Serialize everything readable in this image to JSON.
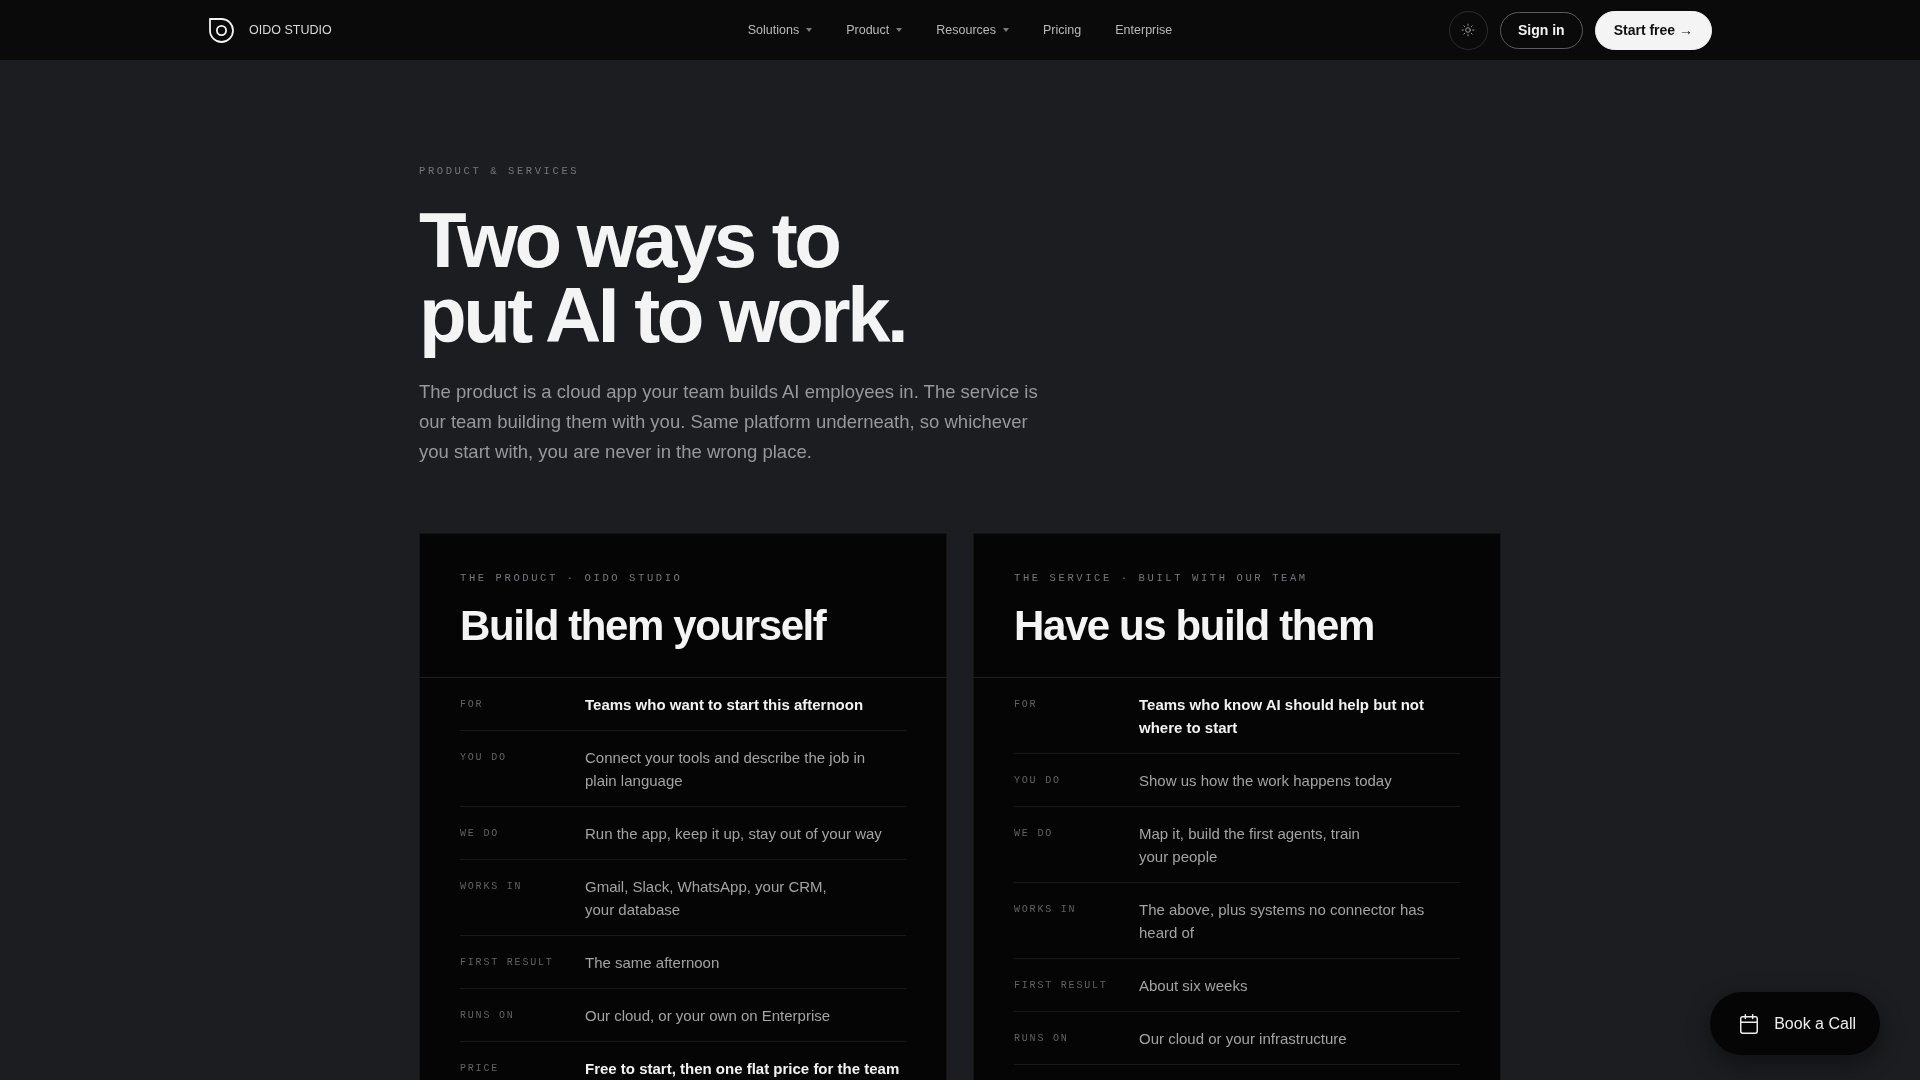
{
  "nav": {
    "brand": "OIDO STUDIO",
    "links": [
      {
        "label": "Solutions",
        "dropdown": true
      },
      {
        "label": "Product",
        "dropdown": true
      },
      {
        "label": "Resources",
        "dropdown": true
      },
      {
        "label": "Pricing",
        "dropdown": false
      },
      {
        "label": "Enterprise",
        "dropdown": false
      }
    ],
    "buttons": [
      {
        "label": "Sign in",
        "kind": "login"
      },
      {
        "label": "Start free →",
        "kind": "signup"
      }
    ]
  },
  "hero": {
    "eyebrow": "PRODUCT & SERVICES",
    "title": "Two ways to\nput AI to work.",
    "intro": "The product is a cloud app your team builds AI employees in. The service is\nour team building them with you. Same platform underneath, so whichever\nyou start with, you are never in the wrong place."
  },
  "cards": [
    {
      "eyebrow": "THE PRODUCT · OIDO STUDIO",
      "title": "Build them yourself",
      "rows": [
        {
          "label": "FOR",
          "value": "Teams who want to start this afternoon",
          "strong": true
        },
        {
          "label": "YOU DO",
          "value": "Connect your tools and describe the job in\nplain language",
          "strong": false
        },
        {
          "label": "WE DO",
          "value": "Run the app, keep it up, stay out of your way",
          "strong": false
        },
        {
          "label": "WORKS IN",
          "value": "Gmail, Slack, WhatsApp, your CRM,\nyour database",
          "strong": false
        },
        {
          "label": "FIRST RESULT",
          "value": "The same afternoon",
          "strong": false
        },
        {
          "label": "RUNS ON",
          "value": "Our cloud, or your own on Enterprise",
          "strong": false
        },
        {
          "label": "PRICE",
          "value": "Free to start, then one flat price for the team",
          "strong": true
        }
      ]
    },
    {
      "eyebrow": "THE SERVICE · BUILT WITH OUR TEAM",
      "title": "Have us build them",
      "rows": [
        {
          "label": "FOR",
          "value": "Teams who know AI should help but not\nwhere to start",
          "strong": true
        },
        {
          "label": "YOU DO",
          "value": "Show us how the work happens today",
          "strong": false
        },
        {
          "label": "WE DO",
          "value": "Map it, build the first agents, train\nyour people",
          "strong": false
        },
        {
          "label": "WORKS IN",
          "value": "The above, plus systems no connector has\nheard of",
          "strong": false
        },
        {
          "label": "FIRST RESULT",
          "value": "About six weeks",
          "strong": false
        },
        {
          "label": "RUNS ON",
          "value": "Our cloud or your infrastructure",
          "strong": false
        }
      ]
    }
  ],
  "floating_button": {
    "label": "Book a Call"
  }
}
